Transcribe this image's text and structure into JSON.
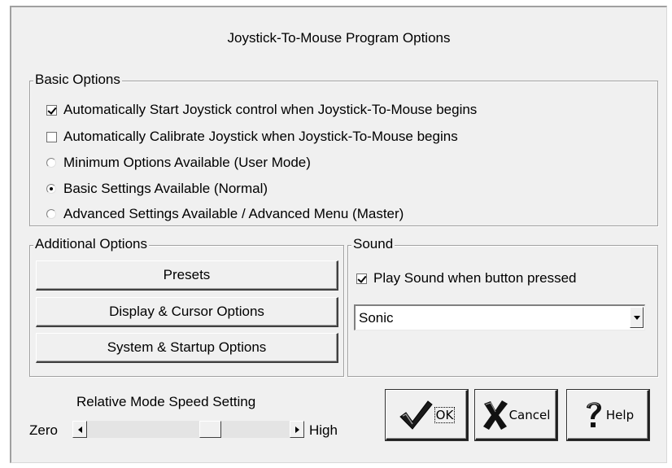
{
  "dialog": {
    "title": "Joystick-To-Mouse Program Options"
  },
  "basic": {
    "legend": "Basic Options",
    "auto_start": {
      "label": "Automatically Start Joystick control when Joystick-To-Mouse begins",
      "checked": true
    },
    "auto_calibrate": {
      "label": "Automatically Calibrate Joystick when Joystick-To-Mouse begins",
      "checked": false
    },
    "modes": [
      {
        "label": "Minimum Options Available (User Mode)",
        "selected": false
      },
      {
        "label": "Basic Settings Available (Normal)",
        "selected": true
      },
      {
        "label": "Advanced Settings Available / Advanced Menu (Master)",
        "selected": false
      }
    ]
  },
  "additional": {
    "legend": "Additional Options",
    "presets_label": "Presets",
    "display_label": "Display & Cursor Options",
    "system_label": "System & Startup Options"
  },
  "sound": {
    "legend": "Sound",
    "play_label": "Play Sound when button pressed",
    "play_checked": true,
    "selected_sound": "Sonic"
  },
  "speed": {
    "label": "Relative Mode Speed Setting",
    "min_label": "Zero",
    "max_label": "High",
    "value_fraction": 0.62
  },
  "buttons": {
    "ok_label": "OK",
    "cancel_label": "Cancel",
    "help_label": "Help"
  },
  "icons": {
    "ok": "checkmark-icon",
    "cancel": "x-icon",
    "help": "question-mark-icon"
  }
}
